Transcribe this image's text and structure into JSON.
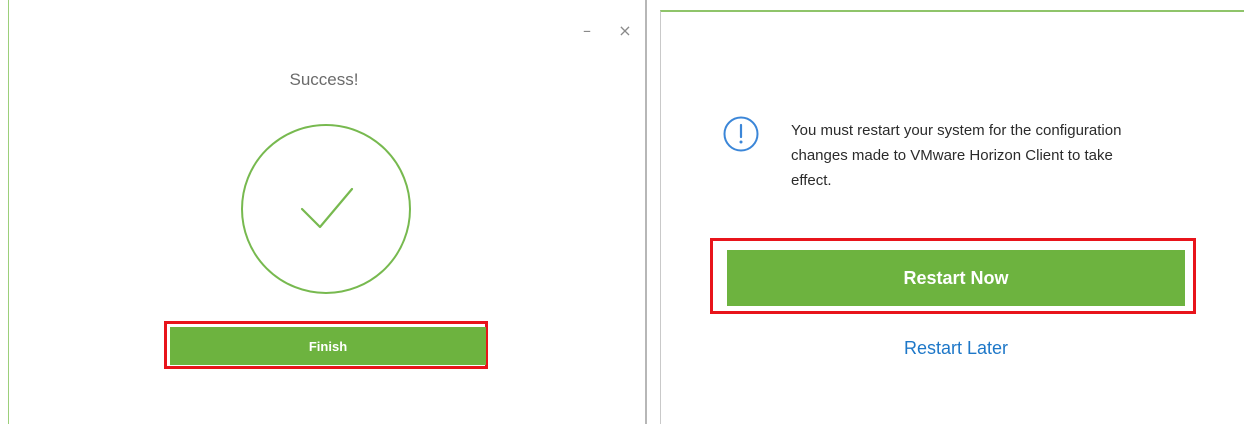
{
  "success_dialog": {
    "title": "Success!",
    "minimize_glyph": "–",
    "close_glyph": "×",
    "icon": "check-circle-icon",
    "finish_label": "Finish"
  },
  "restart_dialog": {
    "icon": "info-icon",
    "message": "You must restart your system for the configuration changes made to VMware Horizon Client to take effect.",
    "restart_now_label": "Restart Now",
    "restart_later_label": "Restart Later"
  },
  "colors": {
    "accent_green": "#6db33f",
    "highlight_red": "#e8141b",
    "link_blue": "#1d77c8",
    "info_blue": "#3b86d8"
  }
}
